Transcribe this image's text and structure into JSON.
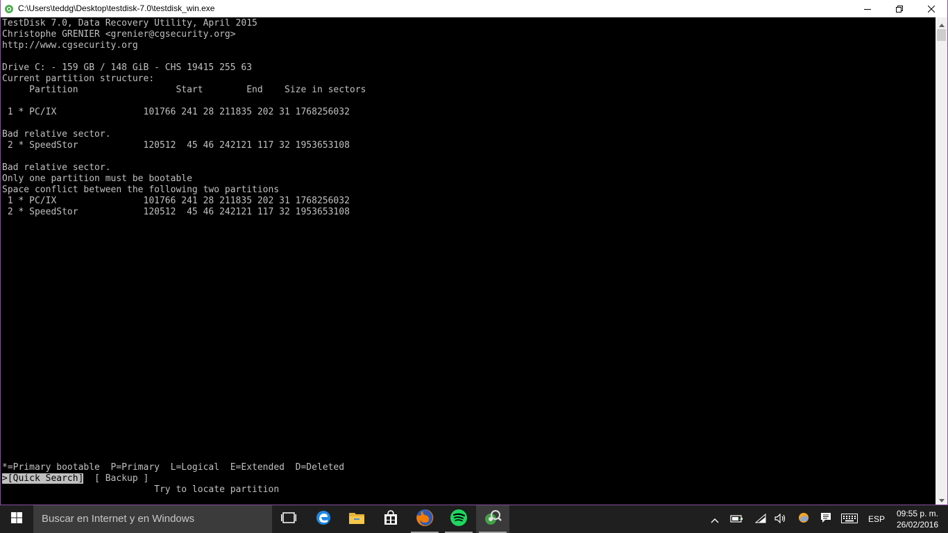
{
  "window": {
    "title": "C:\\Users\\teddg\\Desktop\\testdisk-7.0\\testdisk_win.exe",
    "border_color": "#8a4fa3"
  },
  "console": {
    "lines": [
      "TestDisk 7.0, Data Recovery Utility, April 2015",
      "Christophe GRENIER <grenier@cgsecurity.org>",
      "http://www.cgsecurity.org",
      "",
      "Drive C: - 159 GB / 148 GiB - CHS 19415 255 63",
      "Current partition structure:",
      "     Partition                  Start        End    Size in sectors",
      "",
      " 1 * PC/IX                101766 241 28 211835 202 31 1768256032",
      "",
      "Bad relative sector.",
      " 2 * SpeedStor            120512  45 46 242121 117 32 1953653108",
      "",
      "Bad relative sector.",
      "Only one partition must be bootable",
      "Space conflict between the following two partitions",
      " 1 * PC/IX                101766 241 28 211835 202 31 1768256032",
      " 2 * SpeedStor            120512  45 46 242121 117 32 1953653108"
    ],
    "legend": "*=Primary bootable  P=Primary  L=Logical  E=Extended  D=Deleted",
    "menu": {
      "cursor": ">",
      "quick_search": "[Quick Search]",
      "backup": "[ Backup ]"
    },
    "hint": "                            Try to locate partition",
    "text_color": "#c0c0c0"
  },
  "taskbar": {
    "search_placeholder": "Buscar en Internet y en Windows",
    "language": "ESP",
    "time": "09:55 p. m.",
    "date": "26/02/2016",
    "icons": [
      "task-view-icon",
      "edge-icon",
      "file-explorer-icon",
      "store-icon",
      "firefox-icon",
      "spotify-icon",
      "testdisk-icon"
    ]
  }
}
